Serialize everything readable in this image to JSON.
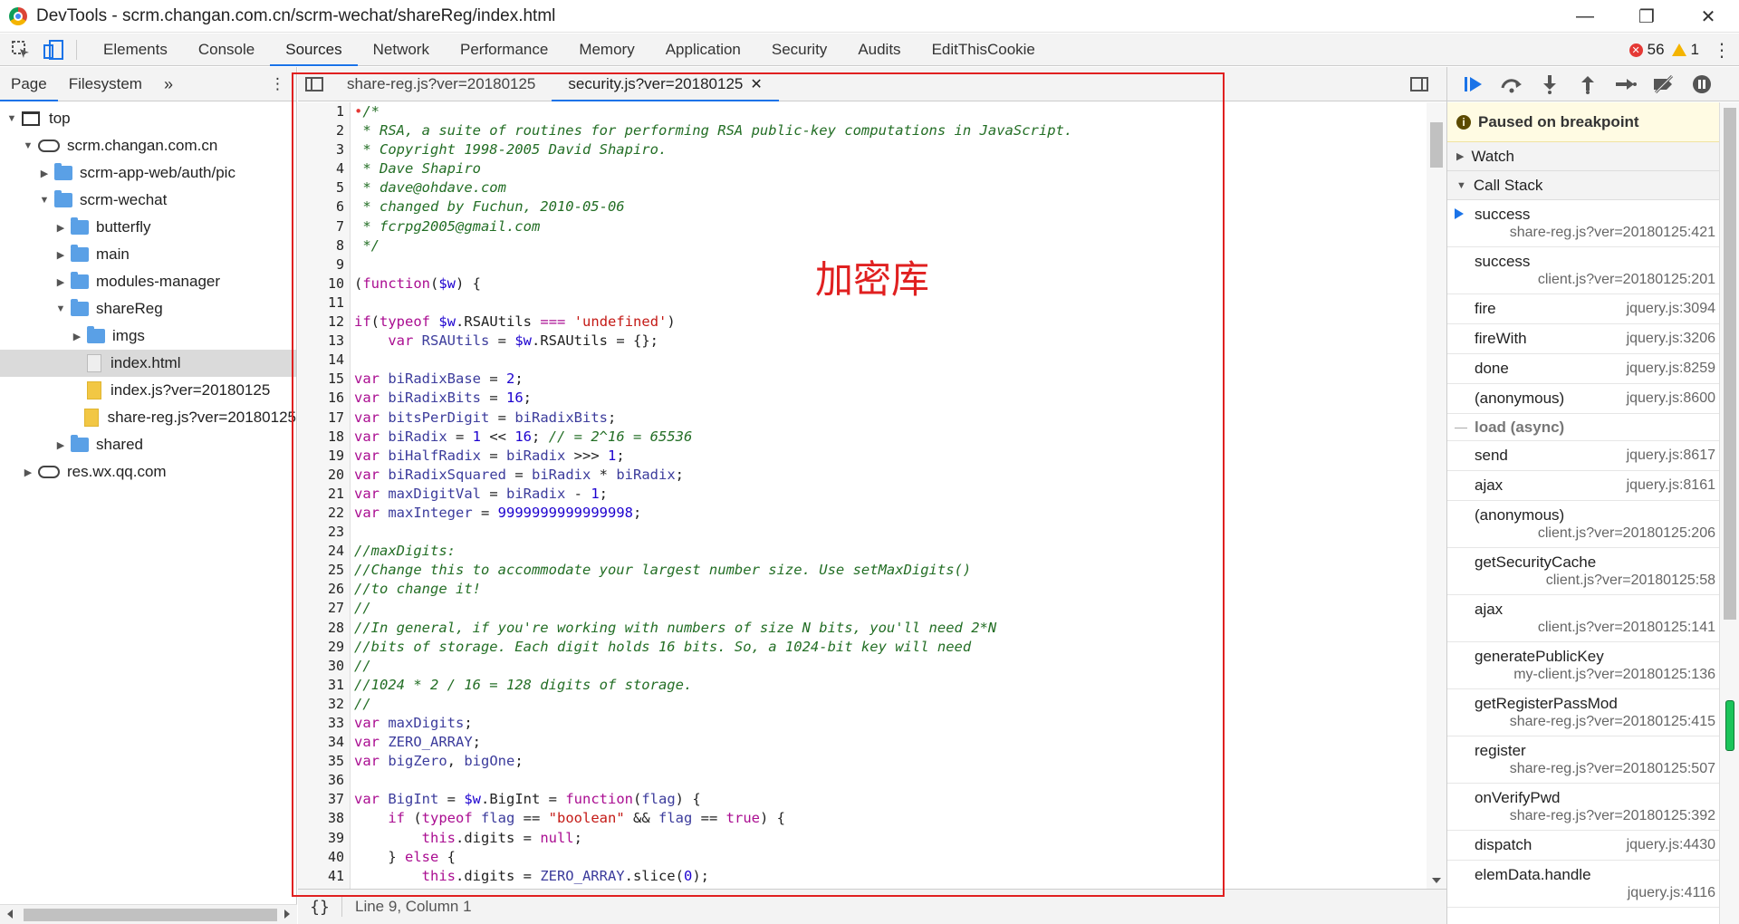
{
  "window": {
    "title": "DevTools - scrm.changan.com.cn/scrm-wechat/shareReg/index.html",
    "buttons": {
      "minimize": "—",
      "restore": "❐",
      "close": "✕"
    }
  },
  "main_tabs": [
    "Elements",
    "Console",
    "Sources",
    "Network",
    "Performance",
    "Memory",
    "Application",
    "Security",
    "Audits",
    "EditThisCookie"
  ],
  "active_main_tab": "Sources",
  "status_counts": {
    "errors": "56",
    "warnings": "1"
  },
  "navigator": {
    "tabs": {
      "page": "Page",
      "filesystem": "Filesystem",
      "more": "»"
    },
    "tree": [
      {
        "label": "top",
        "icon": "frame-icon",
        "depth": 0,
        "arrow": "down"
      },
      {
        "label": "scrm.changan.com.cn",
        "icon": "cloud-icon",
        "depth": 1,
        "arrow": "down"
      },
      {
        "label": "scrm-app-web/auth/pic",
        "icon": "folder-icon",
        "depth": 2,
        "arrow": "right"
      },
      {
        "label": "scrm-wechat",
        "icon": "folder-icon",
        "depth": 2,
        "arrow": "down"
      },
      {
        "label": "butterfly",
        "icon": "folder-icon",
        "depth": 3,
        "arrow": "right"
      },
      {
        "label": "main",
        "icon": "folder-icon",
        "depth": 3,
        "arrow": "right"
      },
      {
        "label": "modules-manager",
        "icon": "folder-icon",
        "depth": 3,
        "arrow": "right"
      },
      {
        "label": "shareReg",
        "icon": "folder-icon",
        "depth": 3,
        "arrow": "down"
      },
      {
        "label": "imgs",
        "icon": "folder-icon",
        "depth": 4,
        "arrow": "right"
      },
      {
        "label": "index.html",
        "icon": "file-icon",
        "depth": 4,
        "arrow": "none",
        "selected": true
      },
      {
        "label": "index.js?ver=20180125",
        "icon": "js-file-icon",
        "depth": 4,
        "arrow": "none"
      },
      {
        "label": "share-reg.js?ver=20180125",
        "icon": "js-file-icon",
        "depth": 4,
        "arrow": "none"
      },
      {
        "label": "shared",
        "icon": "folder-icon",
        "depth": 3,
        "arrow": "right"
      },
      {
        "label": "res.wx.qq.com",
        "icon": "cloud-icon",
        "depth": 1,
        "arrow": "right"
      }
    ]
  },
  "editor": {
    "tabs": [
      {
        "label": "share-reg.js?ver=20180125",
        "active": false
      },
      {
        "label": "security.js?ver=20180125",
        "active": true,
        "close": "✕"
      }
    ],
    "annotation": "加密库",
    "status": {
      "braces": "{}",
      "position": "Line 9, Column 1"
    },
    "code_lines": [
      [
        [
          "bp-dot",
          "•"
        ],
        [
          "cm",
          "/*"
        ]
      ],
      [
        [
          "cm",
          " * RSA, a suite of routines for performing RSA public-key computations in JavaScript."
        ]
      ],
      [
        [
          "cm",
          " * Copyright 1998-2005 David Shapiro."
        ]
      ],
      [
        [
          "cm",
          " * Dave Shapiro"
        ]
      ],
      [
        [
          "cm",
          " * dave@ohdave.com"
        ]
      ],
      [
        [
          "cm",
          " * changed by Fuchun, 2010-05-06"
        ]
      ],
      [
        [
          "cm",
          " * fcrpg2005@gmail.com"
        ]
      ],
      [
        [
          "cm",
          " */"
        ]
      ],
      [],
      [
        [
          "id",
          "("
        ],
        [
          "kw",
          "function"
        ],
        [
          "id",
          "("
        ],
        [
          "vr",
          "$w"
        ],
        [
          "id",
          ") {"
        ]
      ],
      [],
      [
        [
          "kw",
          "if"
        ],
        [
          "id",
          "("
        ],
        [
          "kw",
          "typeof"
        ],
        [
          "id",
          " "
        ],
        [
          "vr",
          "$w"
        ],
        [
          "id",
          ".RSAUtils "
        ],
        [
          "kw",
          "==="
        ],
        [
          "id",
          " "
        ],
        [
          "st",
          "'undefined'"
        ],
        [
          "id",
          ")"
        ]
      ],
      [
        [
          "id",
          "    "
        ],
        [
          "kw",
          "var"
        ],
        [
          "id",
          " "
        ],
        [
          "vn",
          "RSAUtils"
        ],
        [
          "id",
          " = "
        ],
        [
          "vr",
          "$w"
        ],
        [
          "id",
          ".RSAUtils = {};"
        ]
      ],
      [],
      [
        [
          "kw",
          "var"
        ],
        [
          "id",
          " "
        ],
        [
          "vn",
          "biRadixBase"
        ],
        [
          "id",
          " = "
        ],
        [
          "nm",
          "2"
        ],
        [
          "id",
          ";"
        ]
      ],
      [
        [
          "kw",
          "var"
        ],
        [
          "id",
          " "
        ],
        [
          "vn",
          "biRadixBits"
        ],
        [
          "id",
          " = "
        ],
        [
          "nm",
          "16"
        ],
        [
          "id",
          ";"
        ]
      ],
      [
        [
          "kw",
          "var"
        ],
        [
          "id",
          " "
        ],
        [
          "vn",
          "bitsPerDigit"
        ],
        [
          "id",
          " = "
        ],
        [
          "vn",
          "biRadixBits"
        ],
        [
          "id",
          ";"
        ]
      ],
      [
        [
          "kw",
          "var"
        ],
        [
          "id",
          " "
        ],
        [
          "vn",
          "biRadix"
        ],
        [
          "id",
          " = "
        ],
        [
          "nm",
          "1"
        ],
        [
          "id",
          " << "
        ],
        [
          "nm",
          "16"
        ],
        [
          "id",
          "; "
        ],
        [
          "cm",
          "// = 2^16 = 65536"
        ]
      ],
      [
        [
          "kw",
          "var"
        ],
        [
          "id",
          " "
        ],
        [
          "vn",
          "biHalfRadix"
        ],
        [
          "id",
          " = "
        ],
        [
          "vn",
          "biRadix"
        ],
        [
          "id",
          " >>> "
        ],
        [
          "nm",
          "1"
        ],
        [
          "id",
          ";"
        ]
      ],
      [
        [
          "kw",
          "var"
        ],
        [
          "id",
          " "
        ],
        [
          "vn",
          "biRadixSquared"
        ],
        [
          "id",
          " = "
        ],
        [
          "vn",
          "biRadix"
        ],
        [
          "id",
          " * "
        ],
        [
          "vn",
          "biRadix"
        ],
        [
          "id",
          ";"
        ]
      ],
      [
        [
          "kw",
          "var"
        ],
        [
          "id",
          " "
        ],
        [
          "vn",
          "maxDigitVal"
        ],
        [
          "id",
          " = "
        ],
        [
          "vn",
          "biRadix"
        ],
        [
          "id",
          " - "
        ],
        [
          "nm",
          "1"
        ],
        [
          "id",
          ";"
        ]
      ],
      [
        [
          "kw",
          "var"
        ],
        [
          "id",
          " "
        ],
        [
          "vn",
          "maxInteger"
        ],
        [
          "id",
          " = "
        ],
        [
          "nm",
          "9999999999999998"
        ],
        [
          "id",
          ";"
        ]
      ],
      [],
      [
        [
          "cm",
          "//maxDigits:"
        ]
      ],
      [
        [
          "cm",
          "//Change this to accommodate your largest number size. Use setMaxDigits()"
        ]
      ],
      [
        [
          "cm",
          "//to change it!"
        ]
      ],
      [
        [
          "cm",
          "//"
        ]
      ],
      [
        [
          "cm",
          "//In general, if you're working with numbers of size N bits, you'll need 2*N"
        ]
      ],
      [
        [
          "cm",
          "//bits of storage. Each digit holds 16 bits. So, a 1024-bit key will need"
        ]
      ],
      [
        [
          "cm",
          "//"
        ]
      ],
      [
        [
          "cm",
          "//1024 * 2 / 16 = 128 digits of storage."
        ]
      ],
      [
        [
          "cm",
          "//"
        ]
      ],
      [
        [
          "kw",
          "var"
        ],
        [
          "id",
          " "
        ],
        [
          "vn",
          "maxDigits"
        ],
        [
          "id",
          ";"
        ]
      ],
      [
        [
          "kw",
          "var"
        ],
        [
          "id",
          " "
        ],
        [
          "vn",
          "ZERO_ARRAY"
        ],
        [
          "id",
          ";"
        ]
      ],
      [
        [
          "kw",
          "var"
        ],
        [
          "id",
          " "
        ],
        [
          "vn",
          "bigZero"
        ],
        [
          "id",
          ", "
        ],
        [
          "vn",
          "bigOne"
        ],
        [
          "id",
          ";"
        ]
      ],
      [],
      [
        [
          "kw",
          "var"
        ],
        [
          "id",
          " "
        ],
        [
          "vn",
          "BigInt"
        ],
        [
          "id",
          " = "
        ],
        [
          "vr",
          "$w"
        ],
        [
          "id",
          ".BigInt = "
        ],
        [
          "kw",
          "function"
        ],
        [
          "id",
          "("
        ],
        [
          "vn",
          "flag"
        ],
        [
          "id",
          ") {"
        ]
      ],
      [
        [
          "id",
          "    "
        ],
        [
          "kw",
          "if"
        ],
        [
          "id",
          " ("
        ],
        [
          "kw",
          "typeof"
        ],
        [
          "id",
          " "
        ],
        [
          "vn",
          "flag"
        ],
        [
          "id",
          " == "
        ],
        [
          "st",
          "\"boolean\""
        ],
        [
          "id",
          " && "
        ],
        [
          "vn",
          "flag"
        ],
        [
          "id",
          " == "
        ],
        [
          "kw",
          "true"
        ],
        [
          "id",
          ") {"
        ]
      ],
      [
        [
          "id",
          "        "
        ],
        [
          "kw",
          "this"
        ],
        [
          "id",
          ".digits = "
        ],
        [
          "kw",
          "null"
        ],
        [
          "id",
          ";"
        ]
      ],
      [
        [
          "id",
          "    } "
        ],
        [
          "kw",
          "else"
        ],
        [
          "id",
          " {"
        ]
      ],
      [
        [
          "id",
          "        "
        ],
        [
          "kw",
          "this"
        ],
        [
          "id",
          ".digits = "
        ],
        [
          "vn",
          "ZERO_ARRAY"
        ],
        [
          "id",
          ".slice("
        ],
        [
          "nm",
          "0"
        ],
        [
          "id",
          ");"
        ]
      ]
    ]
  },
  "debugger": {
    "paused_text": "Paused on breakpoint",
    "watch": "Watch",
    "call_stack": "Call Stack",
    "frames": [
      {
        "fn": "success",
        "loc": "share-reg.js?ver=20180125:421",
        "layout": "double",
        "current": true
      },
      {
        "fn": "success",
        "loc": "client.js?ver=20180125:201",
        "layout": "double"
      },
      {
        "fn": "fire",
        "loc": "jquery.js:3094",
        "layout": "single"
      },
      {
        "fn": "fireWith",
        "loc": "jquery.js:3206",
        "layout": "single"
      },
      {
        "fn": "done",
        "loc": "jquery.js:8259",
        "layout": "single"
      },
      {
        "fn": "(anonymous)",
        "loc": "jquery.js:8600",
        "layout": "single"
      },
      {
        "async": "load (async)"
      },
      {
        "fn": "send",
        "loc": "jquery.js:8617",
        "layout": "single"
      },
      {
        "fn": "ajax",
        "loc": "jquery.js:8161",
        "layout": "single"
      },
      {
        "fn": "(anonymous)",
        "loc": "client.js?ver=20180125:206",
        "layout": "double"
      },
      {
        "fn": "getSecurityCache",
        "loc": "client.js?ver=20180125:58",
        "layout": "double"
      },
      {
        "fn": "ajax",
        "loc": "client.js?ver=20180125:141",
        "layout": "double"
      },
      {
        "fn": "generatePublicKey",
        "loc": "my-client.js?ver=20180125:136",
        "layout": "double"
      },
      {
        "fn": "getRegisterPassMod",
        "loc": "share-reg.js?ver=20180125:415",
        "layout": "double"
      },
      {
        "fn": "register",
        "loc": "share-reg.js?ver=20180125:507",
        "layout": "double"
      },
      {
        "fn": "onVerifyPwd",
        "loc": "share-reg.js?ver=20180125:392",
        "layout": "double"
      },
      {
        "fn": "dispatch",
        "loc": "jquery.js:4430",
        "layout": "single"
      },
      {
        "fn": "elemData.handle",
        "loc": "jquery.js:4116",
        "layout": "double"
      }
    ]
  },
  "colors": {
    "accent": "#1a73e8",
    "annotation": "#e02020",
    "comment": "#236e25",
    "keyword": "#aa0d91"
  }
}
